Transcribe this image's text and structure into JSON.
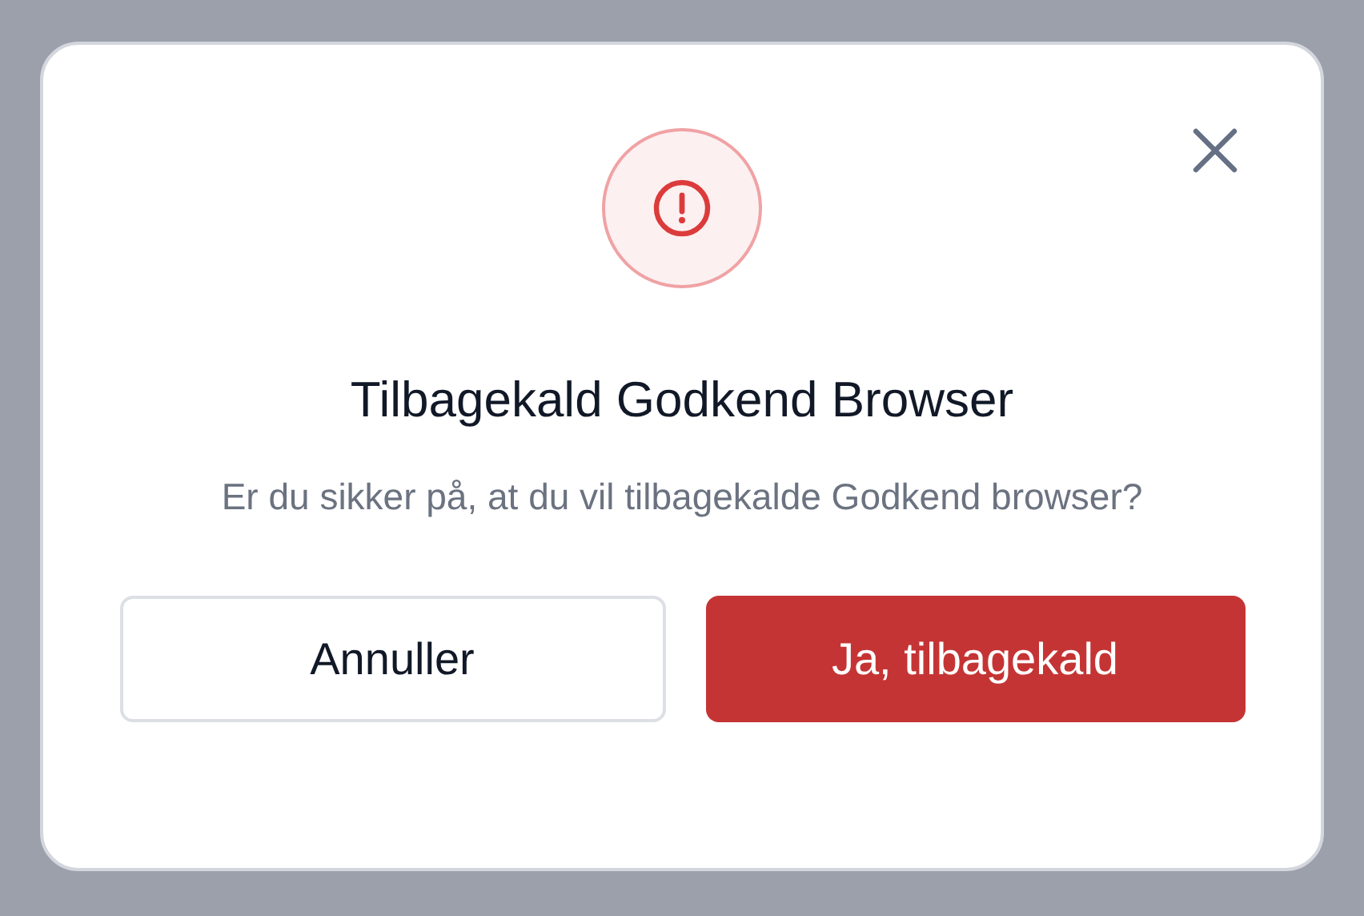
{
  "dialog": {
    "title": "Tilbagekald Godkend Browser",
    "message": "Er du sikker på, at du vil tilbagekalde Godkend browser?",
    "buttons": [
      {
        "label": "Annuller",
        "kind": "secondary"
      },
      {
        "label": "Ja, tilbagekald",
        "kind": "danger"
      }
    ]
  }
}
